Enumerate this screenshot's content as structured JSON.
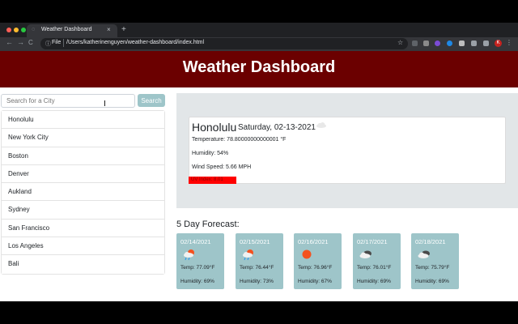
{
  "browser": {
    "tab_title": "Weather Dashboard",
    "tab_close": "×",
    "new_tab": "+",
    "omnibox_file": "File",
    "url": "/Users/katherinenguyen/weather-dashboard/index.html",
    "back": "←",
    "forward": "→",
    "reload": "C",
    "star": "☆",
    "avatar_letter": "K",
    "menu": "⋮",
    "info": "ⓘ"
  },
  "header": {
    "title": "Weather Dashboard",
    "background": "#6b0000"
  },
  "search": {
    "placeholder": "Search for a City",
    "button_label": "Search"
  },
  "cities": [
    "Honolulu",
    "New York City",
    "Boston",
    "Denver",
    "Aukland",
    "Sydney",
    "San Francisco",
    "Los Angeles",
    "Bali"
  ],
  "current": {
    "city": "Honolulu",
    "date": "Saturday, 02-13-2021",
    "icon": "cloud-icon",
    "temperature": "Temperature: 78.80000000000001 °F",
    "humidity": "Humidity: 54%",
    "wind": "Wind Speed: 5.66 MPH",
    "uv": "UV Index: 8.01"
  },
  "forecast_heading": "5 Day Forecast:",
  "forecast": [
    {
      "date": "02/14/2021",
      "icon": "sun-cloud-rain-icon",
      "temp": "Temp: 77.09°F",
      "humidity": "Humidity: 69%"
    },
    {
      "date": "02/15/2021",
      "icon": "sun-cloud-rain-icon",
      "temp": "Temp: 76.44°F",
      "humidity": "Humidity: 73%"
    },
    {
      "date": "02/16/2021",
      "icon": "sun-icon",
      "temp": "Temp: 76.96°F",
      "humidity": "Humidity: 67%"
    },
    {
      "date": "02/17/2021",
      "icon": "dark-cloud-icon",
      "temp": "Temp: 76.01°F",
      "humidity": "Humidity: 69%"
    },
    {
      "date": "02/18/2021",
      "icon": "dark-cloud-icon",
      "temp": "Temp: 75.79°F",
      "humidity": "Humidity: 69%"
    }
  ],
  "colors": {
    "accent": "#9ec5c9",
    "uv_badge": "#ff0000",
    "panel": "#e2e6e8"
  }
}
